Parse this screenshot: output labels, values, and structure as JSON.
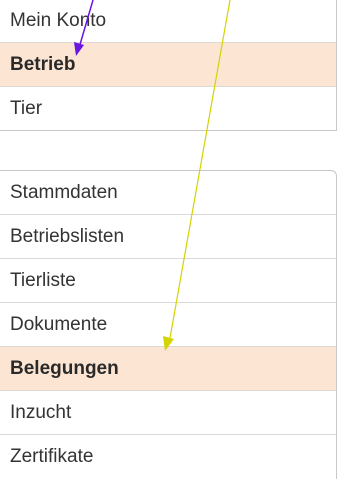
{
  "menu_top": {
    "items": [
      {
        "label": "Mein Konto",
        "active": false
      },
      {
        "label": "Betrieb",
        "active": true
      },
      {
        "label": "Tier",
        "active": false
      }
    ]
  },
  "menu_bottom": {
    "items": [
      {
        "label": "Stammdaten",
        "active": false
      },
      {
        "label": "Betriebslisten",
        "active": false
      },
      {
        "label": "Tierliste",
        "active": false
      },
      {
        "label": "Dokumente",
        "active": false
      },
      {
        "label": "Belegungen",
        "active": true
      },
      {
        "label": "Inzucht",
        "active": false
      },
      {
        "label": "Zertifikate",
        "active": false
      }
    ]
  },
  "colors": {
    "active_bg": "#fce5d2",
    "annotation_purple": "#6a16e0",
    "annotation_yellow": "#d4d400"
  }
}
